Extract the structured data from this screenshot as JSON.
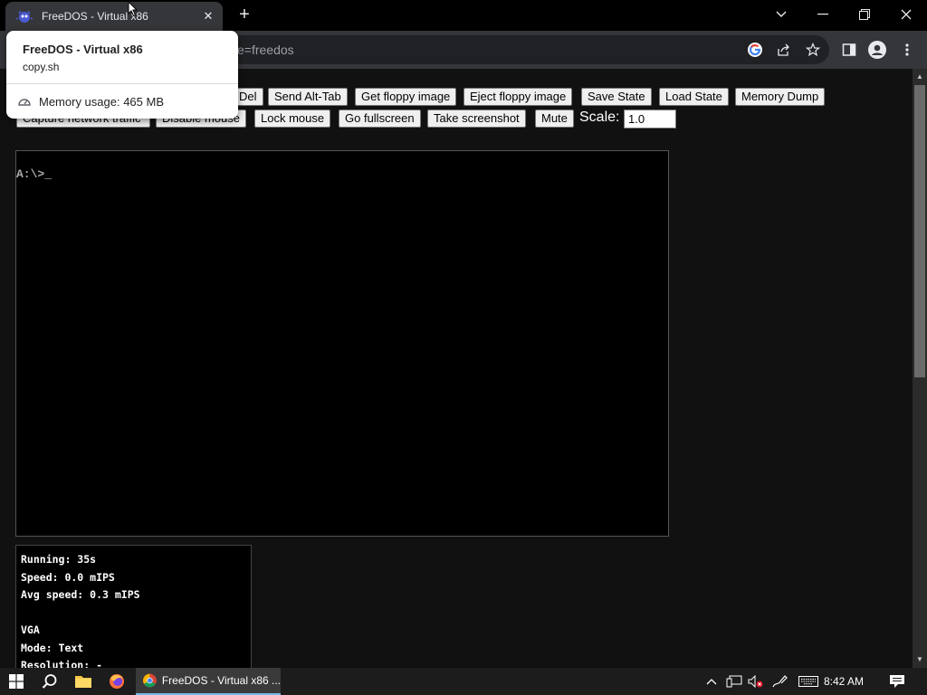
{
  "browser": {
    "tab_title": "FreeDOS - Virtual x86",
    "new_tab": "+",
    "address_text": "e=freedos",
    "window_controls": {
      "minimize": "—",
      "maximize": "❐",
      "close": "✕",
      "tab_search": "⌄"
    }
  },
  "tooltip": {
    "title": "FreeDOS - Virtual x86",
    "url": "copy.sh",
    "memory": "Memory usage: 465 MB"
  },
  "toolbar_buttons": {
    "ctrl_alt_del": "Del",
    "send_alt_tab": "Send Alt-Tab",
    "get_floppy": "Get floppy image",
    "eject_floppy": "Eject floppy image",
    "save_state": "Save State",
    "load_state": "Load State",
    "memory_dump": "Memory Dump",
    "capture_network": "Capture network traffic",
    "disable_mouse": "Disable mouse",
    "lock_mouse": "Lock mouse",
    "go_fullscreen": "Go fullscreen",
    "take_screenshot": "Take screenshot",
    "mute": "Mute"
  },
  "scale": {
    "label": "Scale:",
    "value": "1.0"
  },
  "screen": {
    "prompt": "A:\\>_"
  },
  "stats": {
    "running": "Running: 35s",
    "speed": "Speed: 0.0 mIPS",
    "avg_speed": "Avg speed: 0.3 mIPS",
    "vga_heading": "VGA",
    "mode": "Mode: Text",
    "resolution": "Resolution: -"
  },
  "taskbar": {
    "app_label": "FreeDOS - Virtual x86 ...",
    "clock": "8:42 AM"
  }
}
